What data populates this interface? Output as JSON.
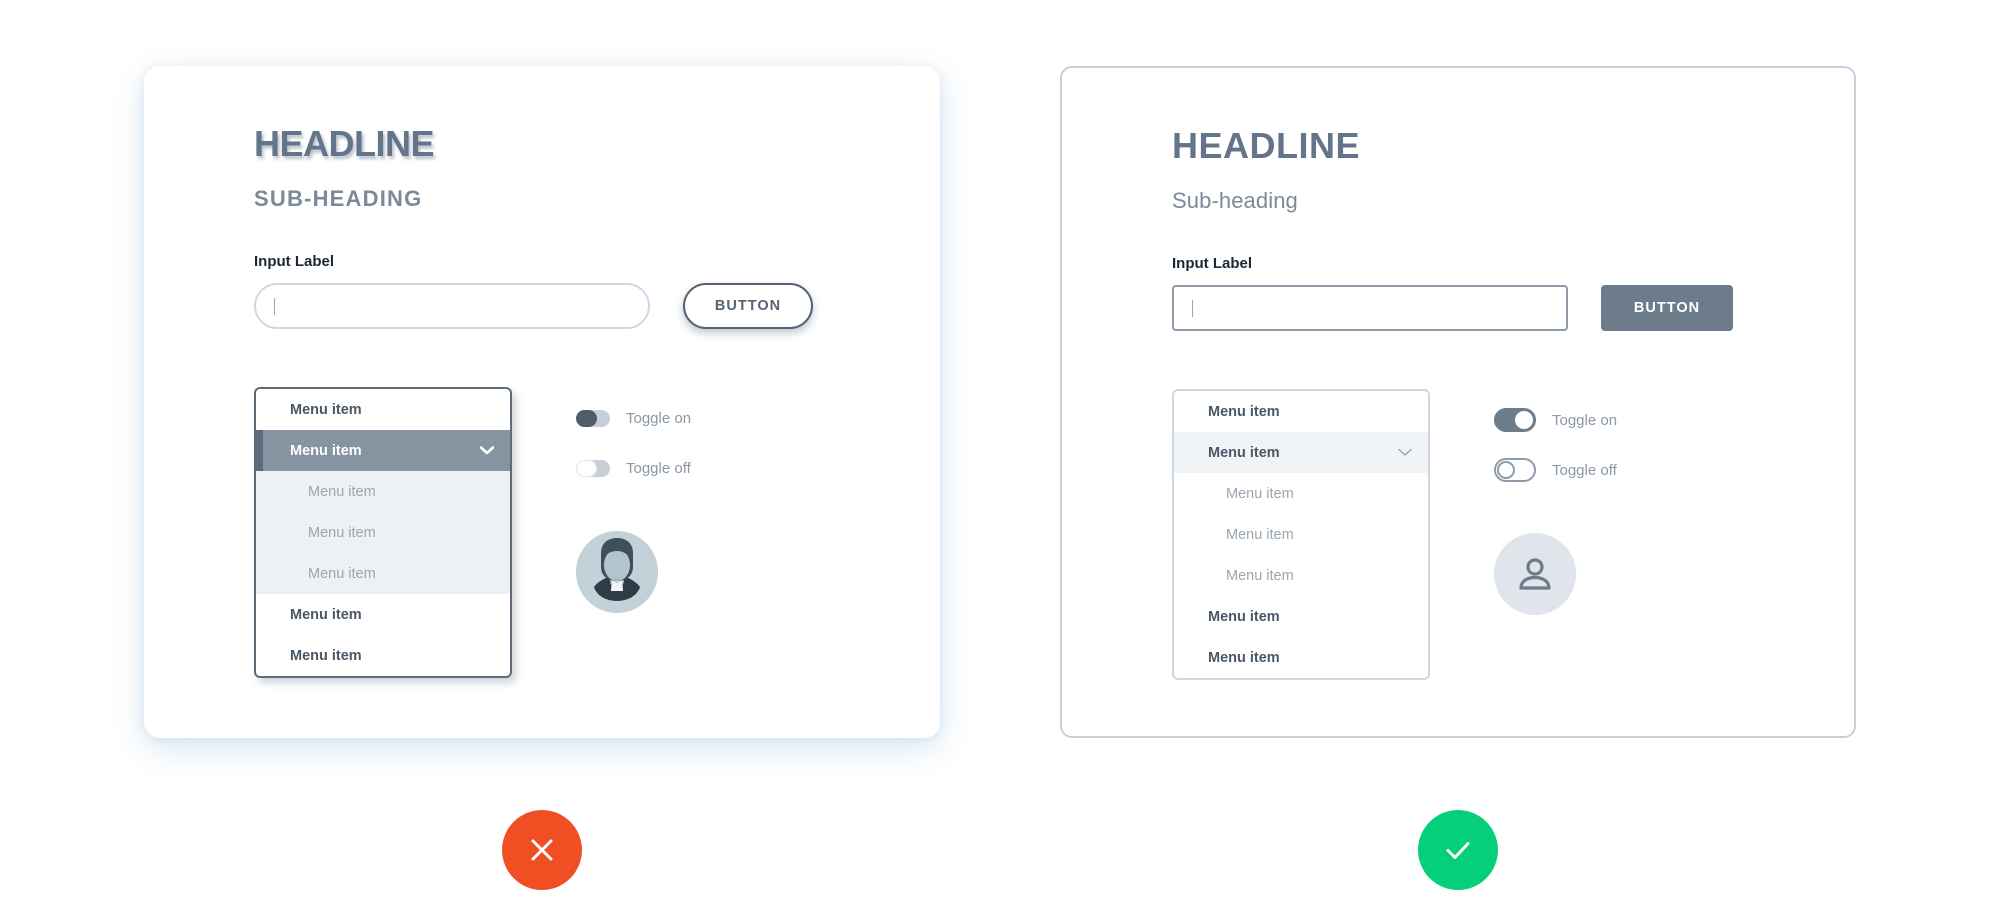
{
  "comparison": {
    "bad": {
      "verdict_icon": "cross-icon",
      "verdict_color": "#f04e23",
      "headline": "HEADLINE",
      "subheading": "SUB-HEADING",
      "input_label": "Input Label",
      "input_value": "",
      "input_placeholder": "",
      "button_label": "BUTTON",
      "menu": {
        "items": [
          {
            "label": "Menu item",
            "level": "top",
            "state": "default"
          },
          {
            "label": "Menu item",
            "level": "top",
            "state": "active",
            "icon": "chevron-down-icon"
          },
          {
            "label": "Menu item",
            "level": "sub",
            "state": "default"
          },
          {
            "label": "Menu item",
            "level": "sub",
            "state": "default"
          },
          {
            "label": "Menu item",
            "level": "sub",
            "state": "default"
          },
          {
            "label": "Menu item",
            "level": "bottom",
            "state": "default"
          },
          {
            "label": "Menu item",
            "level": "bottom",
            "state": "default"
          }
        ]
      },
      "toggles": [
        {
          "label": "Toggle on",
          "state": "on",
          "knob_side": "left"
        },
        {
          "label": "Toggle off",
          "state": "off",
          "knob_side": "left"
        }
      ],
      "avatar_icon": "person-photo-illustration"
    },
    "good": {
      "verdict_icon": "check-icon",
      "verdict_color": "#06cf79",
      "headline": "HEADLINE",
      "subheading": "Sub-heading",
      "input_label": "Input Label",
      "input_value": "",
      "input_placeholder": "",
      "button_label": "BUTTON",
      "menu": {
        "items": [
          {
            "label": "Menu item",
            "level": "top",
            "state": "default"
          },
          {
            "label": "Menu item",
            "level": "top",
            "state": "active",
            "icon": "chevron-down-icon"
          },
          {
            "label": "Menu item",
            "level": "sub",
            "state": "default"
          },
          {
            "label": "Menu item",
            "level": "sub",
            "state": "default"
          },
          {
            "label": "Menu item",
            "level": "sub",
            "state": "default"
          },
          {
            "label": "Menu item",
            "level": "bottom",
            "state": "default"
          },
          {
            "label": "Menu item",
            "level": "bottom",
            "state": "default"
          }
        ]
      },
      "toggles": [
        {
          "label": "Toggle on",
          "state": "on",
          "knob_side": "right"
        },
        {
          "label": "Toggle off",
          "state": "off",
          "knob_side": "left"
        }
      ],
      "avatar_icon": "person-icon"
    }
  }
}
